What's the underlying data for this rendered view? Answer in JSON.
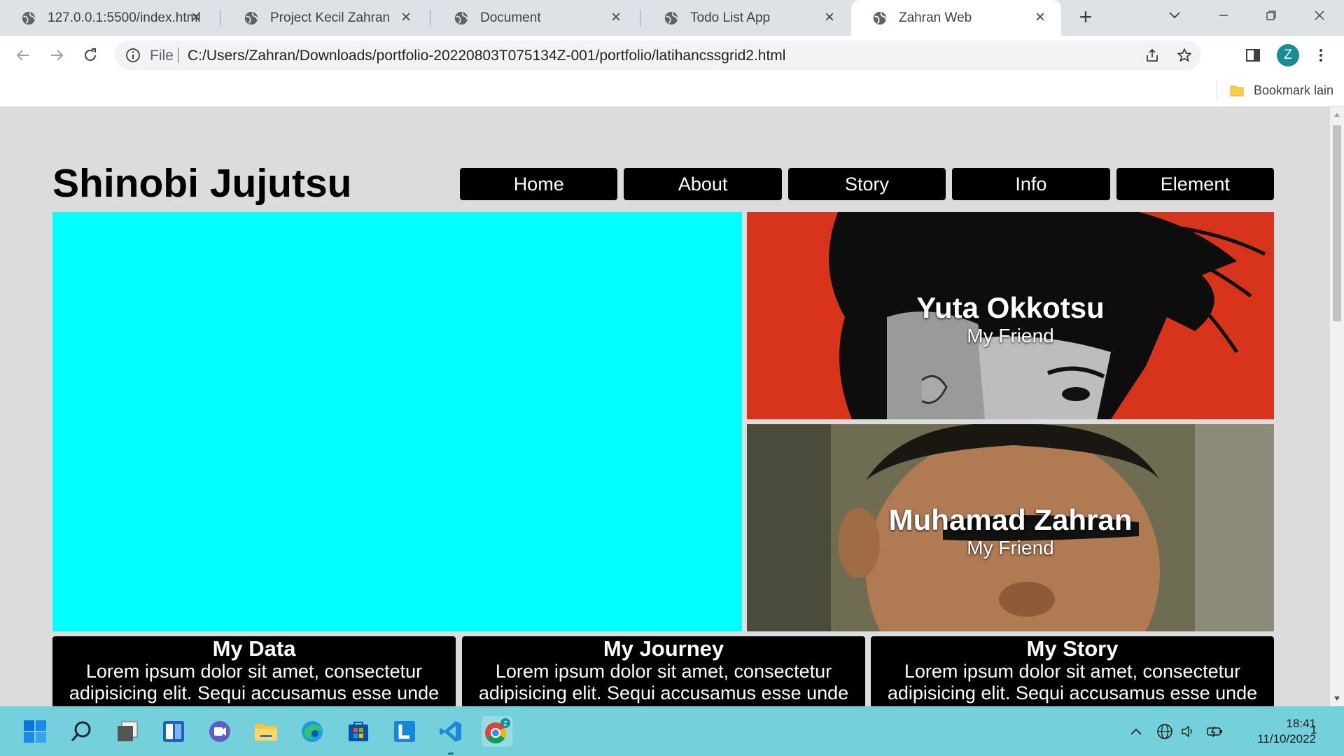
{
  "browser": {
    "tabs": [
      {
        "label": "127.0.0.1:5500/index.html"
      },
      {
        "label": "Project Kecil Zahran"
      },
      {
        "label": "Document"
      },
      {
        "label": "Todo List App"
      },
      {
        "label": "Zahran Web"
      }
    ],
    "omnibox": {
      "scheme_label": "File",
      "url": "C:/Users/Zahran/Downloads/portfolio-20220803T075134Z-001/portfolio/latihancssgrid2.html"
    },
    "profile_initial": "Z",
    "bookmarks": {
      "other_label": "Bookmark lain"
    }
  },
  "page": {
    "title": "Shinobi Jujutsu",
    "nav": [
      "Home",
      "About",
      "Story",
      "Info",
      "Element"
    ],
    "hero_color": "#00ffff",
    "cards": [
      {
        "name": "Yuta Okkotsu",
        "subtitle": "My Friend"
      },
      {
        "name": "Muhamad Zahran",
        "subtitle": "My Friend"
      }
    ],
    "info_boxes": [
      {
        "title": "My Data",
        "body": "Lorem ipsum dolor sit amet, consectetur adipisicing elit. Sequi accusamus esse unde"
      },
      {
        "title": "My Journey",
        "body": "Lorem ipsum dolor sit amet, consectetur adipisicing elit. Sequi accusamus esse unde"
      },
      {
        "title": "My Story",
        "body": "Lorem ipsum dolor sit amet, consectetur adipisicing elit. Sequi accusamus esse unde"
      }
    ]
  },
  "taskbar": {
    "apps": [
      "start-icon",
      "search-icon",
      "task-view-icon",
      "widgets-icon",
      "teams-chat-icon",
      "file-explorer-icon",
      "edge-icon",
      "microsoft-store-icon",
      "l-app-icon",
      "vscode-icon",
      "chrome-icon"
    ],
    "clock": {
      "time": "18:41",
      "date": "11/10/2022"
    },
    "notification_count": "1"
  },
  "colors": {
    "accent_teal": "#74d0da",
    "nav_black": "#000000",
    "card_red": "#d8341c"
  }
}
